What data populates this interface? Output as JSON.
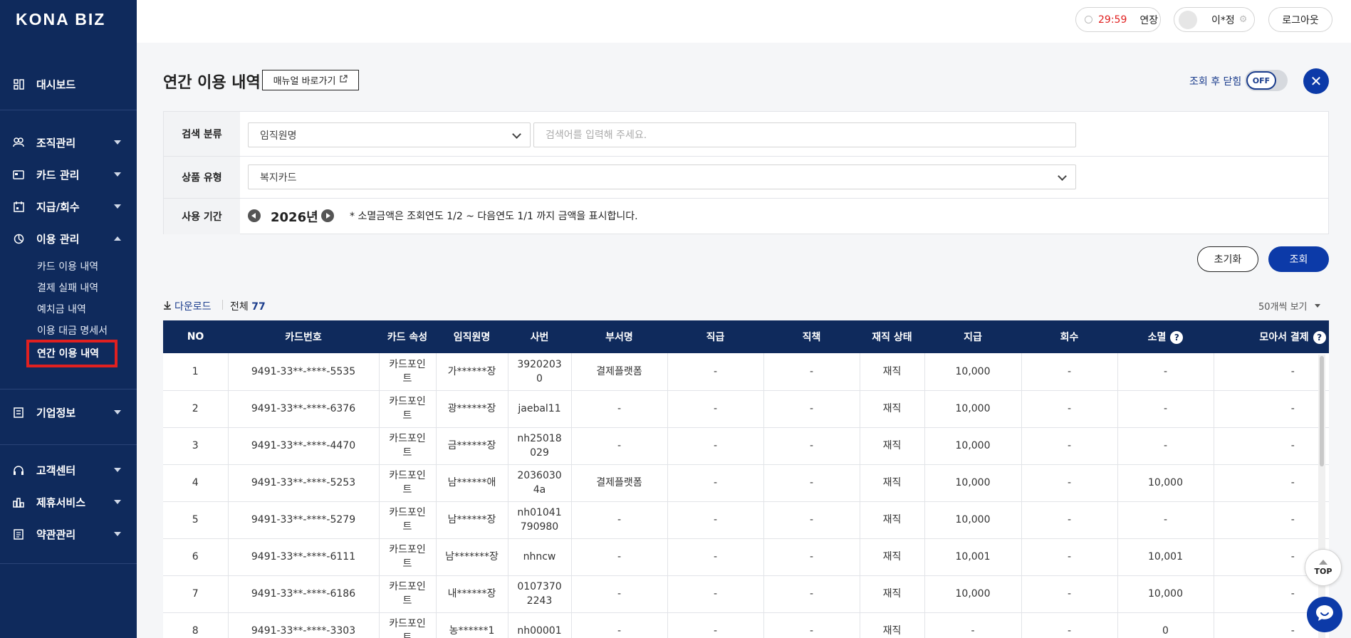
{
  "sidebar": {
    "logo": "KONA BIZ",
    "dashboard": "대시보드",
    "org": "조직관리",
    "card": "카드 관리",
    "pay": "지급/회수",
    "usage": "이용 관리",
    "usage_sub": [
      "카드 이용 내역",
      "결제 실패 내역",
      "예치금 내역",
      "이용 대금 명세서",
      "연간 이용 내역"
    ],
    "company": "기업정보",
    "support": "고객센터",
    "partner": "제휴서비스",
    "terms": "약관관리"
  },
  "topbar": {
    "timer": "29:59",
    "extend": "연장",
    "user": "이*정",
    "logout": "로그아웃"
  },
  "page": {
    "title": "연간 이용 내역",
    "manual": "매뉴얼 바로가기",
    "close_after_label": "조회 후 닫힘",
    "toggle": "OFF"
  },
  "filter": {
    "search_category_label": "검색 분류",
    "search_category_value": "임직원명",
    "search_placeholder": "검색어를 입력해 주세요.",
    "product_label": "상품 유형",
    "product_value": "복지카드",
    "period_label": "사용 기간",
    "year": "2026년",
    "note": "* 소멸금액은 조회연도 1/2 ~ 다음연도 1/1 까지 금액을 표시합니다."
  },
  "actions": {
    "reset": "초기화",
    "search": "조회"
  },
  "list": {
    "download": "다운로드",
    "total_label": "전체",
    "total_count": "77",
    "page_size": "50개씩 보기"
  },
  "table": {
    "headers": [
      "NO",
      "카드번호",
      "카드 속성",
      "임직원명",
      "사번",
      "부서명",
      "직급",
      "직책",
      "재직 상태",
      "지급",
      "회수",
      "소멸",
      "모아서 결제"
    ],
    "rows": [
      [
        "1",
        "9491-33**-****-5535",
        "카드포인트",
        "가******장",
        "39202030",
        "결제플랫폼",
        "-",
        "-",
        "재직",
        "10,000",
        "-",
        "-",
        "-"
      ],
      [
        "2",
        "9491-33**-****-6376",
        "카드포인트",
        "광******장",
        "jaebal11",
        "-",
        "-",
        "-",
        "재직",
        "10,000",
        "-",
        "-",
        "-"
      ],
      [
        "3",
        "9491-33**-****-4470",
        "카드포인트",
        "금******장",
        "nh25018029",
        "-",
        "-",
        "-",
        "재직",
        "10,000",
        "-",
        "-",
        "-"
      ],
      [
        "4",
        "9491-33**-****-5253",
        "카드포인트",
        "남******애",
        "20360304a",
        "결제플랫폼",
        "-",
        "-",
        "재직",
        "10,000",
        "-",
        "10,000",
        "-"
      ],
      [
        "5",
        "9491-33**-****-5279",
        "카드포인트",
        "남******장",
        "nh01041790980",
        "-",
        "-",
        "-",
        "재직",
        "10,000",
        "-",
        "-",
        "-"
      ],
      [
        "6",
        "9491-33**-****-6111",
        "카드포인트",
        "남*******장",
        "nhncw",
        "-",
        "-",
        "-",
        "재직",
        "10,001",
        "-",
        "10,001",
        "-"
      ],
      [
        "7",
        "9491-33**-****-6186",
        "카드포인트",
        "내******장",
        "01073702243",
        "-",
        "-",
        "-",
        "재직",
        "10,000",
        "-",
        "10,000",
        "-"
      ],
      [
        "8",
        "9491-33**-****-3303",
        "카드포인트",
        "농******1",
        "nh00001",
        "-",
        "-",
        "-",
        "재직",
        "-",
        "-",
        "0",
        "-"
      ]
    ]
  },
  "floating": {
    "top": "TOP"
  }
}
